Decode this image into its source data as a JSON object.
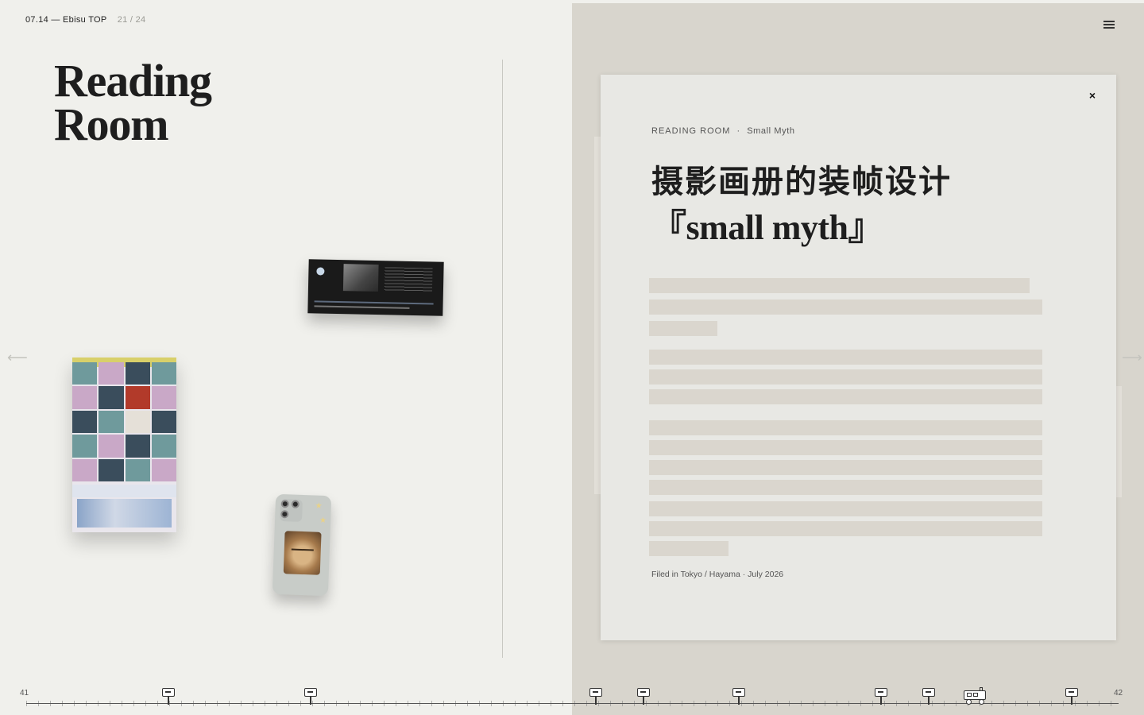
{
  "header": {
    "location": "07.14 — Ebisu TOP",
    "pager": "21 / 24"
  },
  "page": {
    "title_line1": "Reading",
    "title_line2": "Room"
  },
  "nav": {
    "prev_arrow": "⟵",
    "next_arrow": "⟶",
    "menu_icon": "hamburger-menu-icon"
  },
  "modal": {
    "close_label": "×",
    "crumb_section": "READING ROOM",
    "crumb_separator": "·",
    "crumb_sub": "Small Myth",
    "title_line1": "摄影画册的装帧设计",
    "title_line2": "『small myth』",
    "footer": "Filed in Tokyo / Hayama · July 2026"
  },
  "timeline": {
    "start": "41",
    "end": "42",
    "marker_count": 10
  },
  "colors": {
    "left_bg": "#f0f0ec",
    "right_bg": "#d8d5cd",
    "modal_bg": "#e8e8e4",
    "redaction_bar": "#dad6ce",
    "text": "#1e1e1e"
  }
}
